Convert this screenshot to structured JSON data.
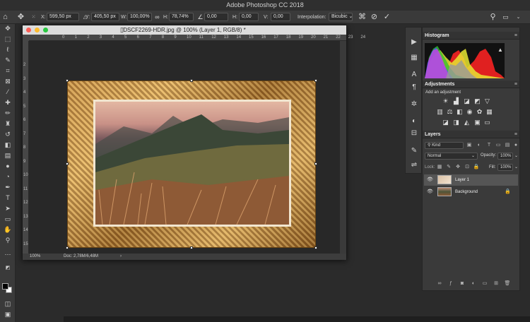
{
  "app": {
    "title": "Adobe Photoshop CC 2018"
  },
  "options": {
    "x_label": "X:",
    "x_value": "599,50 px",
    "y_label": "Y:",
    "y_value": "405,50 px",
    "w_label": "W:",
    "w_value": "100,00%",
    "h_label": "H:",
    "h_value": "78,74%",
    "angle_value": "0,00",
    "hskew_label": "H:",
    "hskew_value": "0,00",
    "vskew_label": "V:",
    "vskew_value": "0,00",
    "interp_label": "Interpolation:",
    "interp_value": "Bicubic"
  },
  "document": {
    "title": "DSCF2269-HDR.jpg @ 100% (Layer 1, RGB/8) *",
    "zoom": "100%",
    "doc_info": "Doc: 2,78M/6,48M",
    "ruler_h": [
      "0",
      "1",
      "2",
      "3",
      "4",
      "5",
      "6",
      "7",
      "8",
      "9",
      "10",
      "11",
      "12",
      "13",
      "14",
      "15",
      "16",
      "17",
      "18",
      "19",
      "20",
      "21",
      "22",
      "23",
      "24"
    ],
    "ruler_v": [
      "2",
      "3",
      "4",
      "5",
      "6",
      "7",
      "8",
      "9",
      "10",
      "11",
      "12",
      "13",
      "14",
      "15"
    ]
  },
  "panels": {
    "histogram_tab": "Histogram",
    "adjustments_tab": "Adjustments",
    "add_adjustment": "Add an adjustment",
    "layers_tab": "Layers",
    "filter_kind": "Kind",
    "blend_mode": "Normal",
    "opacity_label": "Opacity:",
    "opacity_value": "100%",
    "lock_label": "Lock:",
    "fill_label": "Fill:",
    "fill_value": "100%",
    "layers": [
      {
        "name": "Layer 1"
      },
      {
        "name": "Background"
      }
    ]
  },
  "colors": {
    "fg": "#000000",
    "bg": "#ffffff",
    "selected_layer": "#555555"
  }
}
